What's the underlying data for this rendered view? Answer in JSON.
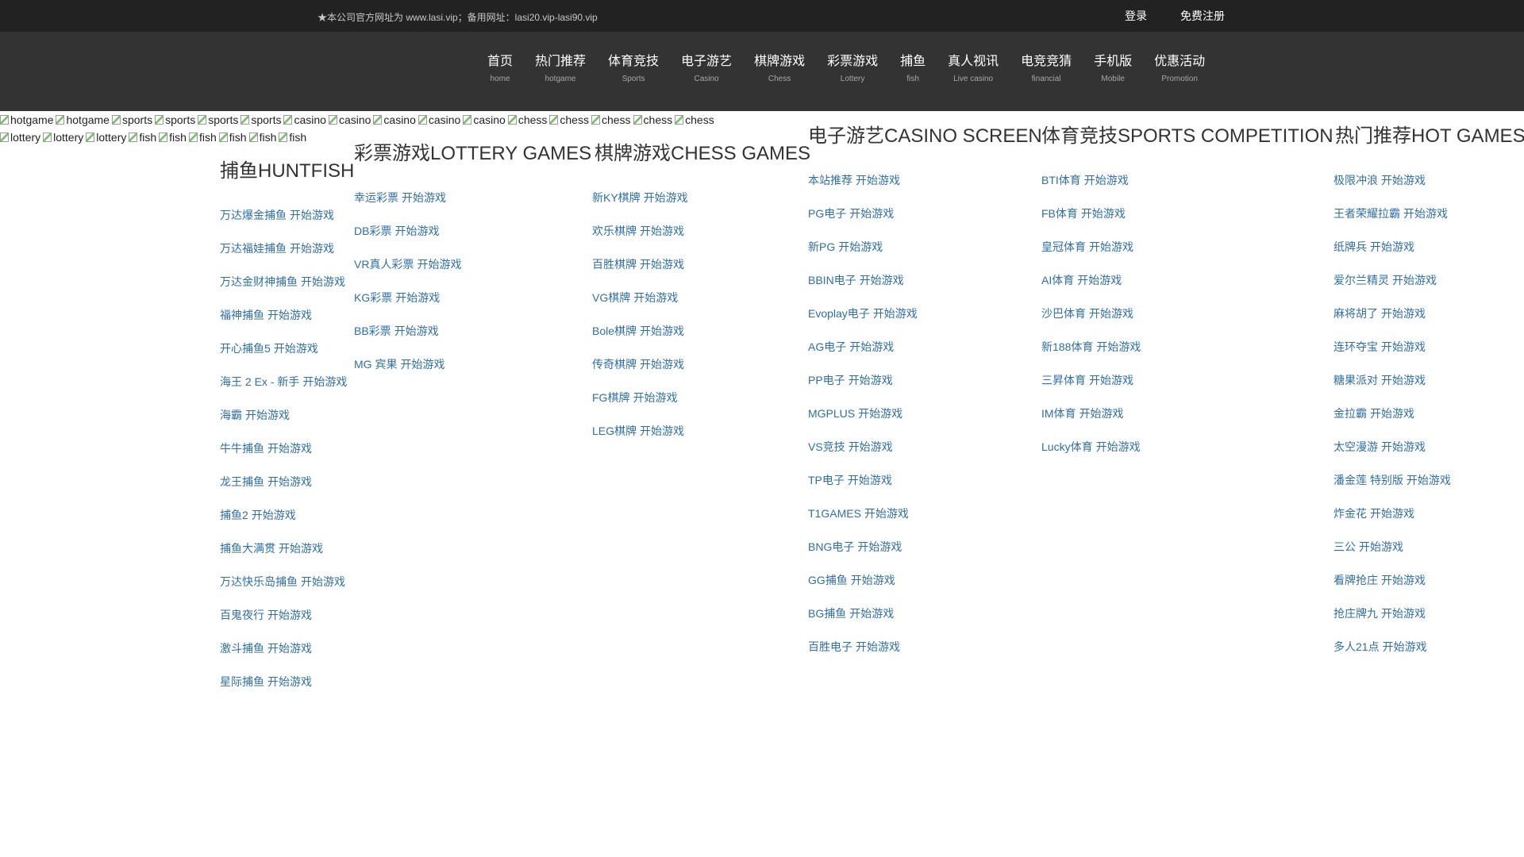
{
  "topbar": {
    "notice": "★本公司官方网址为 www.lasi.vip；备用网址：lasi20.vip-lasi90.vip",
    "login": "登录",
    "signup": "免费注册"
  },
  "nav": [
    {
      "cn": "首页",
      "en": "home"
    },
    {
      "cn": "热门推荐",
      "en": "hotgame"
    },
    {
      "cn": "体育竞技",
      "en": "Sports"
    },
    {
      "cn": "电子游艺",
      "en": "Casino"
    },
    {
      "cn": "棋牌游戏",
      "en": "Chess"
    },
    {
      "cn": "彩票游戏",
      "en": "Lottery"
    },
    {
      "cn": "捕鱼",
      "en": "fish"
    },
    {
      "cn": "真人视讯",
      "en": "Live casino"
    },
    {
      "cn": "电竞竞猜",
      "en": "financial"
    },
    {
      "cn": "手机版",
      "en": "Mobile"
    },
    {
      "cn": "优惠活动",
      "en": "Promotion"
    }
  ],
  "broken_images": {
    "row1": [
      "hotgame",
      "hotgame",
      "sports",
      "sports",
      "sports",
      "sports",
      "casino",
      "casino",
      "casino",
      "casino",
      "casino",
      "chess",
      "chess",
      "chess",
      "chess",
      "chess"
    ],
    "row2": [
      "lottery",
      "lottery",
      "lottery",
      "fish",
      "fish",
      "fish",
      "fish",
      "fish",
      "fish"
    ]
  },
  "play_label": "开始游戏",
  "sections": {
    "casino": {
      "title": "电子游艺CASINO SCREEN"
    },
    "sports": {
      "title": "体育竞技SPORTS COMPETITION"
    },
    "hot": {
      "title": "热门推荐HOT GAMES"
    },
    "lottery": {
      "title": "彩票游戏LOTTERY GAMES"
    },
    "chess": {
      "title": "棋牌游戏CHESS GAMES"
    },
    "fish": {
      "title": "捕鱼HUNTFISH"
    }
  },
  "games": {
    "fish": [
      "万达爆金捕鱼",
      "万达福娃捕鱼",
      "万达金财神捕鱼",
      "福神捕鱼",
      "开心捕鱼5",
      "海王 2 Ex - 新手",
      "海霸",
      "牛牛捕鱼",
      "龙王捕鱼",
      "捕鱼2",
      "捕鱼大满贯",
      "万达快乐岛捕鱼",
      "百鬼夜行",
      "激斗捕鱼",
      "星际捕鱼"
    ],
    "lottery": [
      "幸运彩票",
      "DB彩票",
      "VR真人彩票",
      "KG彩票",
      "BB彩票",
      "MG 宾果"
    ],
    "chess": [
      "新KY棋牌",
      "欢乐棋牌",
      "百胜棋牌",
      "VG棋牌",
      "Bole棋牌",
      "传奇棋牌",
      "FG棋牌",
      "LEG棋牌"
    ],
    "casino": [
      "本站推荐",
      "PG电子",
      "新PG",
      "BBIN电子",
      "Evoplay电子",
      "AG电子",
      "PP电子",
      "MGPLUS",
      "VS竞技",
      "TP电子",
      "T1GAMES",
      "BNG电子",
      "GG捕鱼",
      "BG捕鱼",
      "百胜电子"
    ],
    "sports": [
      "BTI体育",
      "FB体育",
      "皇冠体育",
      "AI体育",
      "沙巴体育",
      "新188体育",
      "三昇体育",
      "IM体育",
      "Lucky体育"
    ],
    "hot": [
      "极限冲浪",
      "王者荣耀拉霸",
      "纸牌兵",
      "爱尔兰精灵",
      "麻将胡了",
      "连环夺宝",
      "糖果派对",
      "金拉霸",
      "太空漫游",
      "潘金莲 特别版",
      "炸金花",
      "三公",
      "看牌抢庄",
      "抢庄牌九",
      "多人21点"
    ]
  }
}
